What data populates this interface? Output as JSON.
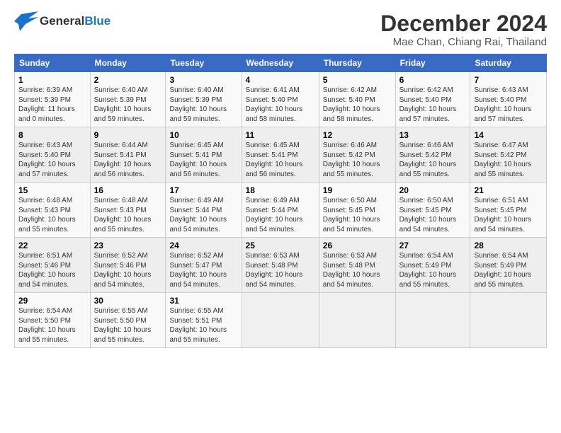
{
  "header": {
    "logo_general": "General",
    "logo_blue": "Blue",
    "month_title": "December 2024",
    "location": "Mae Chan, Chiang Rai, Thailand"
  },
  "days_of_week": [
    "Sunday",
    "Monday",
    "Tuesday",
    "Wednesday",
    "Thursday",
    "Friday",
    "Saturday"
  ],
  "weeks": [
    [
      {
        "day": "1",
        "info": "Sunrise: 6:39 AM\nSunset: 5:39 PM\nDaylight: 11 hours\nand 0 minutes."
      },
      {
        "day": "2",
        "info": "Sunrise: 6:40 AM\nSunset: 5:39 PM\nDaylight: 10 hours\nand 59 minutes."
      },
      {
        "day": "3",
        "info": "Sunrise: 6:40 AM\nSunset: 5:39 PM\nDaylight: 10 hours\nand 59 minutes."
      },
      {
        "day": "4",
        "info": "Sunrise: 6:41 AM\nSunset: 5:40 PM\nDaylight: 10 hours\nand 58 minutes."
      },
      {
        "day": "5",
        "info": "Sunrise: 6:42 AM\nSunset: 5:40 PM\nDaylight: 10 hours\nand 58 minutes."
      },
      {
        "day": "6",
        "info": "Sunrise: 6:42 AM\nSunset: 5:40 PM\nDaylight: 10 hours\nand 57 minutes."
      },
      {
        "day": "7",
        "info": "Sunrise: 6:43 AM\nSunset: 5:40 PM\nDaylight: 10 hours\nand 57 minutes."
      }
    ],
    [
      {
        "day": "8",
        "info": "Sunrise: 6:43 AM\nSunset: 5:40 PM\nDaylight: 10 hours\nand 57 minutes."
      },
      {
        "day": "9",
        "info": "Sunrise: 6:44 AM\nSunset: 5:41 PM\nDaylight: 10 hours\nand 56 minutes."
      },
      {
        "day": "10",
        "info": "Sunrise: 6:45 AM\nSunset: 5:41 PM\nDaylight: 10 hours\nand 56 minutes."
      },
      {
        "day": "11",
        "info": "Sunrise: 6:45 AM\nSunset: 5:41 PM\nDaylight: 10 hours\nand 56 minutes."
      },
      {
        "day": "12",
        "info": "Sunrise: 6:46 AM\nSunset: 5:42 PM\nDaylight: 10 hours\nand 55 minutes."
      },
      {
        "day": "13",
        "info": "Sunrise: 6:46 AM\nSunset: 5:42 PM\nDaylight: 10 hours\nand 55 minutes."
      },
      {
        "day": "14",
        "info": "Sunrise: 6:47 AM\nSunset: 5:42 PM\nDaylight: 10 hours\nand 55 minutes."
      }
    ],
    [
      {
        "day": "15",
        "info": "Sunrise: 6:48 AM\nSunset: 5:43 PM\nDaylight: 10 hours\nand 55 minutes."
      },
      {
        "day": "16",
        "info": "Sunrise: 6:48 AM\nSunset: 5:43 PM\nDaylight: 10 hours\nand 55 minutes."
      },
      {
        "day": "17",
        "info": "Sunrise: 6:49 AM\nSunset: 5:44 PM\nDaylight: 10 hours\nand 54 minutes."
      },
      {
        "day": "18",
        "info": "Sunrise: 6:49 AM\nSunset: 5:44 PM\nDaylight: 10 hours\nand 54 minutes."
      },
      {
        "day": "19",
        "info": "Sunrise: 6:50 AM\nSunset: 5:45 PM\nDaylight: 10 hours\nand 54 minutes."
      },
      {
        "day": "20",
        "info": "Sunrise: 6:50 AM\nSunset: 5:45 PM\nDaylight: 10 hours\nand 54 minutes."
      },
      {
        "day": "21",
        "info": "Sunrise: 6:51 AM\nSunset: 5:45 PM\nDaylight: 10 hours\nand 54 minutes."
      }
    ],
    [
      {
        "day": "22",
        "info": "Sunrise: 6:51 AM\nSunset: 5:46 PM\nDaylight: 10 hours\nand 54 minutes."
      },
      {
        "day": "23",
        "info": "Sunrise: 6:52 AM\nSunset: 5:46 PM\nDaylight: 10 hours\nand 54 minutes."
      },
      {
        "day": "24",
        "info": "Sunrise: 6:52 AM\nSunset: 5:47 PM\nDaylight: 10 hours\nand 54 minutes."
      },
      {
        "day": "25",
        "info": "Sunrise: 6:53 AM\nSunset: 5:48 PM\nDaylight: 10 hours\nand 54 minutes."
      },
      {
        "day": "26",
        "info": "Sunrise: 6:53 AM\nSunset: 5:48 PM\nDaylight: 10 hours\nand 54 minutes."
      },
      {
        "day": "27",
        "info": "Sunrise: 6:54 AM\nSunset: 5:49 PM\nDaylight: 10 hours\nand 55 minutes."
      },
      {
        "day": "28",
        "info": "Sunrise: 6:54 AM\nSunset: 5:49 PM\nDaylight: 10 hours\nand 55 minutes."
      }
    ],
    [
      {
        "day": "29",
        "info": "Sunrise: 6:54 AM\nSunset: 5:50 PM\nDaylight: 10 hours\nand 55 minutes."
      },
      {
        "day": "30",
        "info": "Sunrise: 6:55 AM\nSunset: 5:50 PM\nDaylight: 10 hours\nand 55 minutes."
      },
      {
        "day": "31",
        "info": "Sunrise: 6:55 AM\nSunset: 5:51 PM\nDaylight: 10 hours\nand 55 minutes."
      },
      {
        "day": "",
        "info": ""
      },
      {
        "day": "",
        "info": ""
      },
      {
        "day": "",
        "info": ""
      },
      {
        "day": "",
        "info": ""
      }
    ]
  ]
}
